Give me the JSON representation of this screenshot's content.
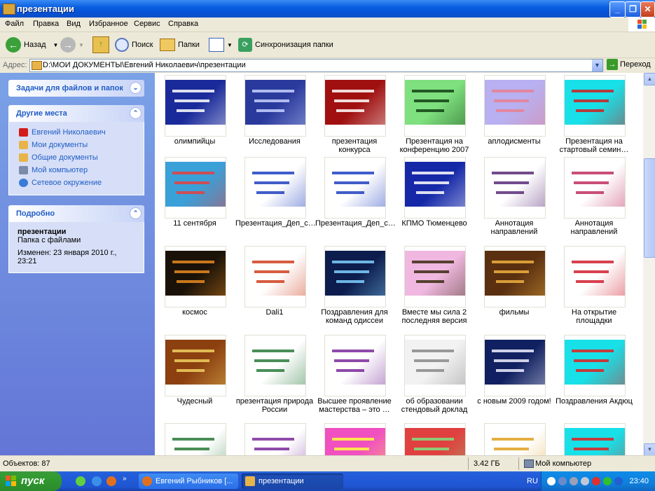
{
  "window": {
    "title": "презентации"
  },
  "menu": [
    "Файл",
    "Правка",
    "Вид",
    "Избранное",
    "Сервис",
    "Справка"
  ],
  "toolbar": {
    "back": "Назад",
    "search": "Поиск",
    "folders": "Папки",
    "sync": "Синхронизация папки"
  },
  "address": {
    "label": "Адрес:",
    "path": "D:\\МОИ ДОКУМЕНТЫ\\Евгений Николаевич\\презентации",
    "go": "Переход"
  },
  "panels": {
    "tasks": {
      "title": "Задачи для файлов и папок"
    },
    "places": {
      "title": "Другие места",
      "items": [
        {
          "label": "Евгений Николаевич",
          "icon": "folder-red-icon",
          "color": "#d21c1c"
        },
        {
          "label": "Мои документы",
          "icon": "my-documents-icon",
          "color": "#e8b449"
        },
        {
          "label": "Общие документы",
          "icon": "shared-documents-icon",
          "color": "#e8b449"
        },
        {
          "label": "Мой компьютер",
          "icon": "my-computer-icon",
          "color": "#7a8ca8"
        },
        {
          "label": "Сетевое окружение",
          "icon": "network-icon",
          "color": "#3a7ad8"
        }
      ]
    },
    "details": {
      "title": "Подробно",
      "name": "презентации",
      "type": "Папка с файлами",
      "modified": "Изменен: 23 января 2010 г., 23:21"
    }
  },
  "files": [
    {
      "name": "олимпийцы",
      "bg": "#1a2a9a",
      "fg": "#ffffff"
    },
    {
      "name": "Исследования",
      "bg": "#2a3a9c",
      "fg": "#c8d2ff"
    },
    {
      "name": "презентация конкурса",
      "bg": "#a01010",
      "fg": "#ffffff"
    },
    {
      "name": "Презентация на конференцию 2007",
      "bg": "#7ee07e",
      "fg": "#124012"
    },
    {
      "name": "аплодисменты",
      "bg": "#b8b0f0",
      "fg": "#e88090"
    },
    {
      "name": "Презентация на стартовый семин…",
      "bg": "#18e0e8",
      "fg": "#d02020"
    },
    {
      "name": "11 сентября",
      "bg": "#3aa0d8",
      "fg": "#e84040"
    },
    {
      "name": "Презентация_Деп_с…",
      "bg": "#ffffff",
      "fg": "#2040c0"
    },
    {
      "name": "Презентация_Деп_с…",
      "bg": "#ffffff",
      "fg": "#2040c0"
    },
    {
      "name": "КПМО Тюменцево",
      "bg": "#1428a8",
      "fg": "#ffffff"
    },
    {
      "name": "Аннотация направлений",
      "bg": "#ffffff",
      "fg": "#5a2c78"
    },
    {
      "name": "Аннотация направлений",
      "bg": "#ffffff",
      "fg": "#c03060"
    },
    {
      "name": "космос",
      "bg": "#1a1208",
      "fg": "#e88a20"
    },
    {
      "name": "Dali1",
      "bg": "#ffffff",
      "fg": "#d04020"
    },
    {
      "name": "Поздравления для команд одиссеи",
      "bg": "#0c1c4c",
      "fg": "#80d0ff"
    },
    {
      "name": "Вместе мы сила 2 последняя версия",
      "bg": "#f0b8e0",
      "fg": "#3a2a10"
    },
    {
      "name": "фильмы",
      "bg": "#5a3010",
      "fg": "#f0b040"
    },
    {
      "name": "На открытие площадки",
      "bg": "#ffffff",
      "fg": "#d02030"
    },
    {
      "name": "Чудесный",
      "bg": "#8c4010",
      "fg": "#f0d060"
    },
    {
      "name": "презентация природа России",
      "bg": "#ffffff",
      "fg": "#2a7a3a"
    },
    {
      "name": "Высшее проявление мастерства – это …",
      "bg": "#ffffff",
      "fg": "#7a2a9a"
    },
    {
      "name": "об образовании стендовый доклад",
      "bg": "#f2f2f2",
      "fg": "#8a8a8a"
    },
    {
      "name": "с новым 2009 годом!",
      "bg": "#102060",
      "fg": "#f0f0ff"
    },
    {
      "name": "Поздравления Акдюц",
      "bg": "#18e0e8",
      "fg": "#e02020"
    },
    {
      "name": "",
      "bg": "#ffffff",
      "fg": "#2a7a3a"
    },
    {
      "name": "",
      "bg": "#ffffff",
      "fg": "#7a2a9a"
    },
    {
      "name": "",
      "bg": "#f050c0",
      "fg": "#ffff40"
    },
    {
      "name": "",
      "bg": "#e04040",
      "fg": "#80e080"
    },
    {
      "name": "",
      "bg": "#ffffff",
      "fg": "#e0a020"
    },
    {
      "name": "",
      "bg": "#18e0e8",
      "fg": "#e02020"
    }
  ],
  "status": {
    "objects": "Объектов: 87",
    "size": "3.42 ГБ",
    "location": "Мой компьютер"
  },
  "taskbar": {
    "start": "пуск",
    "tasks": [
      "Евгений Рыбников [...",
      "презентации"
    ],
    "lang": "RU",
    "clock": "23:40"
  }
}
